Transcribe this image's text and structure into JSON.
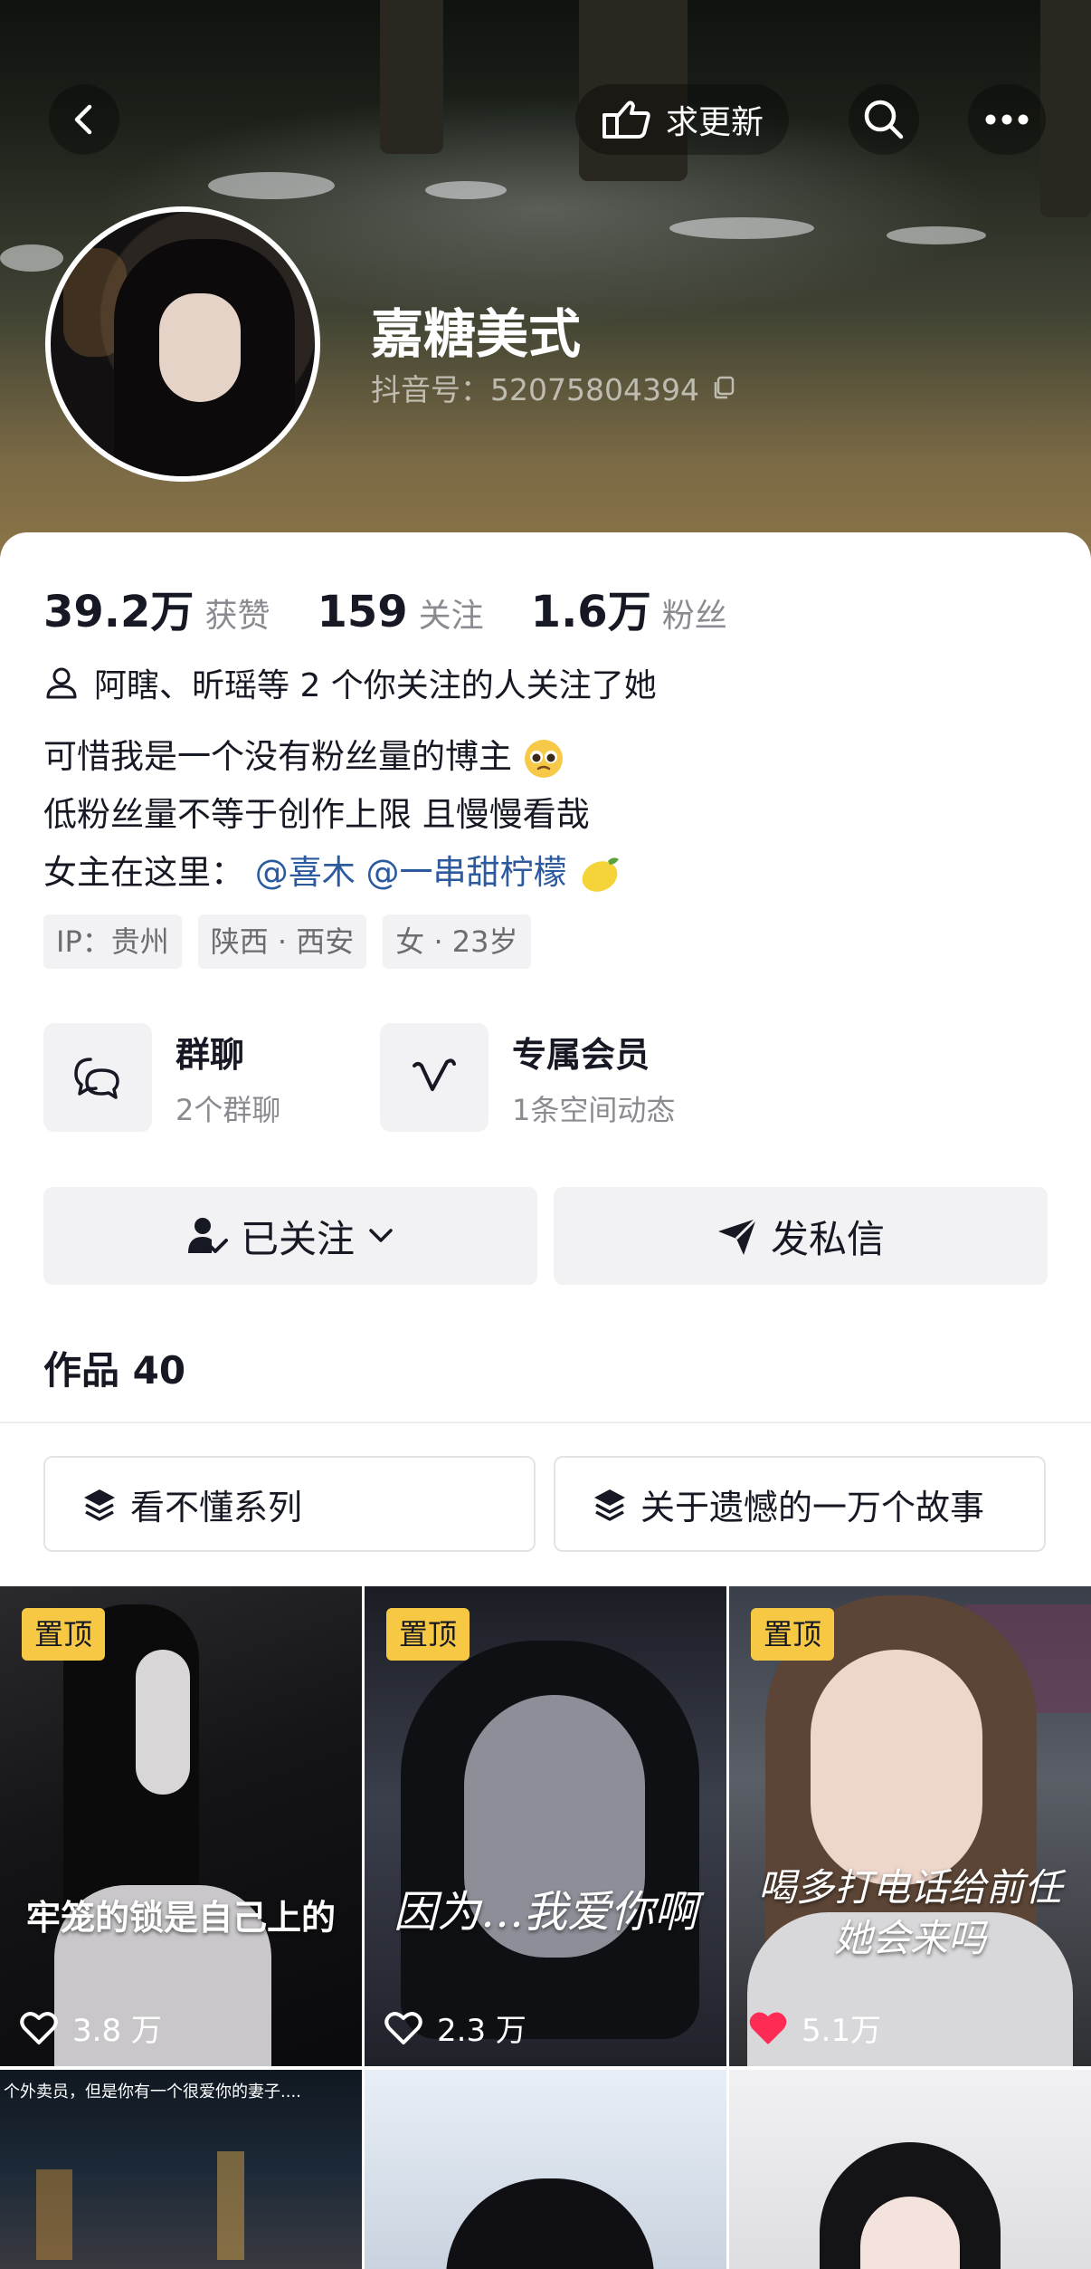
{
  "header": {
    "request_update_label": "求更新",
    "icons": [
      "back-icon",
      "hand-point-icon",
      "search-icon",
      "more-icon"
    ]
  },
  "profile": {
    "nickname": "嘉糖美式",
    "douyin_id": "抖音号：52075804394"
  },
  "stats": [
    {
      "value": "39.2万",
      "label": "获赞"
    },
    {
      "value": "159",
      "label": "关注"
    },
    {
      "value": "1.6万",
      "label": "粉丝"
    }
  ],
  "mutual_follow": "阿瞎、昕瑶等 2 个你关注的人关注了她",
  "bio": {
    "line1": "可惜我是一个没有粉丝量的博主",
    "line2": "低粉丝量不等于创作上限 且慢慢看哉",
    "line3_prefix": "女主在这里：",
    "mention1": "@喜木",
    "mention2": "@一串甜柠檬"
  },
  "tags": [
    "IP：贵州",
    "陕西 · 西安",
    "女 · 23岁"
  ],
  "entries": {
    "group_chat": {
      "title": "群聊",
      "subtitle": "2个群聊"
    },
    "membership": {
      "title": "专属会员",
      "subtitle": "1条空间动态"
    }
  },
  "actions": {
    "followed_label": "已关注",
    "message_label": "发私信"
  },
  "works": {
    "title": "作品 40",
    "series": [
      "看不懂系列",
      "关于遗憾的一万个故事"
    ],
    "pinned_label": "置顶",
    "videos": [
      {
        "caption": "牢笼的锁是自己上的",
        "likes": "3.8 万",
        "liked": false
      },
      {
        "caption": "因为…我爱你啊",
        "likes": "2.3 万",
        "liked": false
      },
      {
        "caption": "喝多打电话给前任 她会来吗",
        "likes": "5.1万",
        "liked": true
      }
    ],
    "row2_top_text": "个外卖员，但是你有一个很爱你的妻子...."
  },
  "colors": {
    "accent_mention": "#2b5a9e",
    "pin_badge": "#f6c844",
    "liked_heart": "#fe2c55"
  }
}
